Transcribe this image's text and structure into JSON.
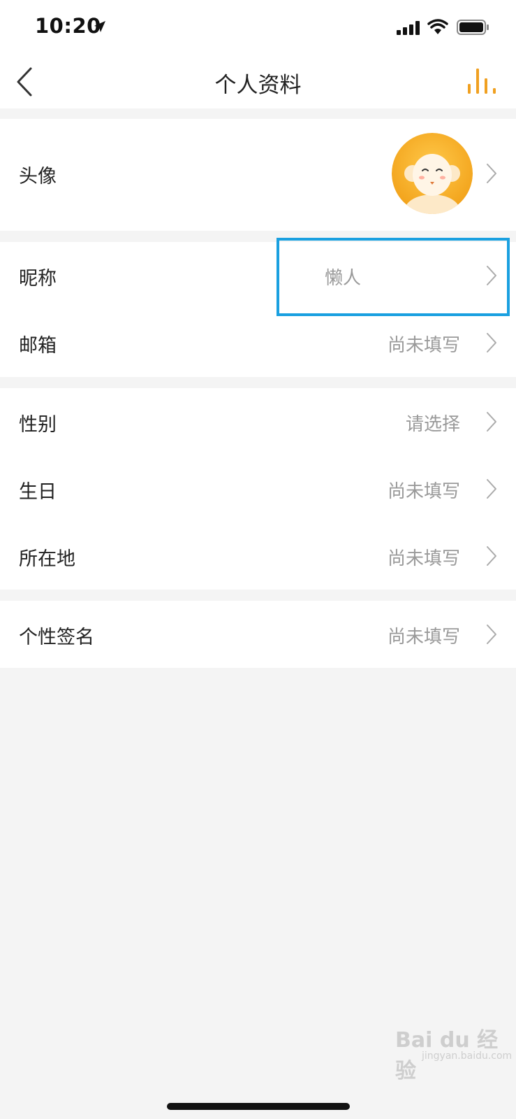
{
  "status_bar": {
    "time": "10:20",
    "icons": [
      "location-arrow-icon",
      "cellular-signal-icon",
      "wifi-icon",
      "battery-icon"
    ]
  },
  "nav": {
    "title": "个人资料",
    "back_icon": "chevron-left-icon",
    "right_icon": "bar-stats-icon",
    "accent_color": "#f0a020"
  },
  "profile": {
    "avatar": {
      "label": "头像",
      "image": "monkey-avatar"
    },
    "nickname": {
      "label": "昵称",
      "value": "懒人"
    },
    "email": {
      "label": "邮箱",
      "value": "尚未填写"
    },
    "gender": {
      "label": "性别",
      "value": "请选择"
    },
    "birthday": {
      "label": "生日",
      "value": "尚未填写"
    },
    "location": {
      "label": "所在地",
      "value": "尚未填写"
    },
    "signature": {
      "label": "个性签名",
      "value": "尚未填写"
    }
  },
  "highlight_color": "#1aa0e0",
  "watermark": {
    "main": "Bai du 经验",
    "sub": "jingyan.baidu.com"
  }
}
